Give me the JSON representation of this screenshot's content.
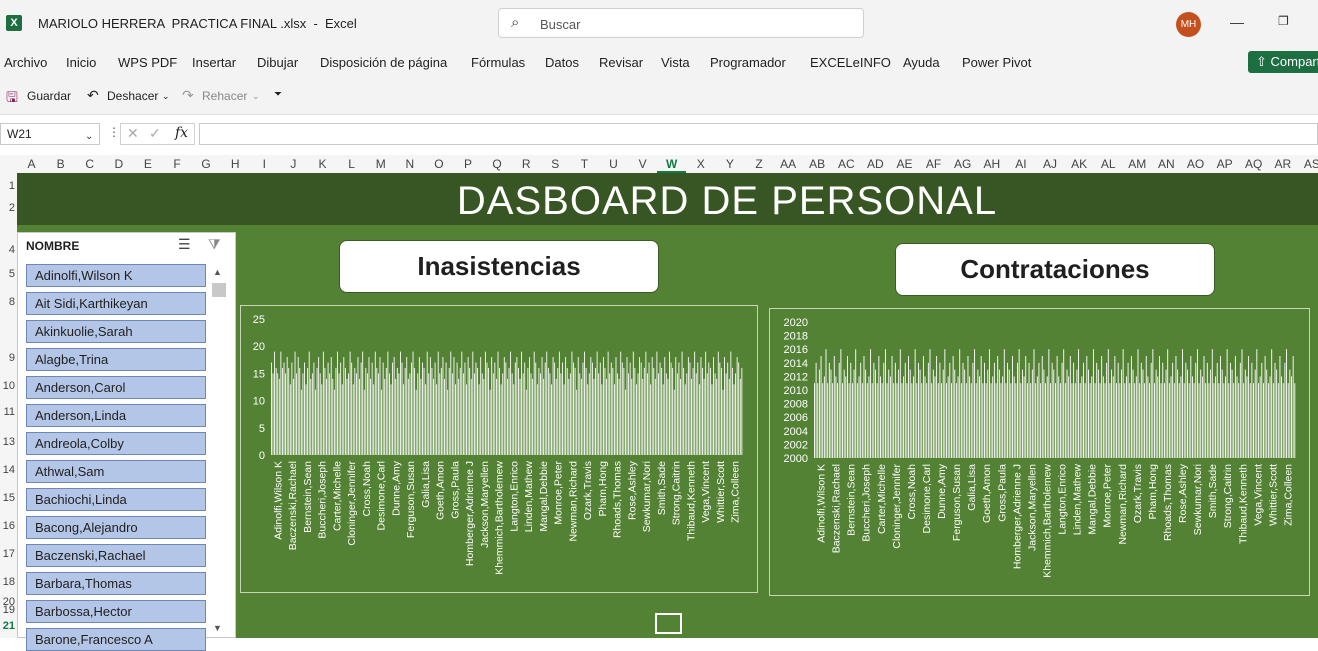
{
  "window": {
    "title": "MARIOLO HERRERA  PRACTICA FINAL .xlsx  -  Excel",
    "search_placeholder": "Buscar",
    "avatar_initials": "MH",
    "minimize_glyph": "—",
    "restore_glyph": "❐"
  },
  "menu": {
    "items": [
      "Archivo",
      "Inicio",
      "WPS PDF",
      "Insertar",
      "Dibujar",
      "Disposición de página",
      "Fórmulas",
      "Datos",
      "Revisar",
      "Vista",
      "Programador",
      "EXCELeINFO",
      "Ayuda",
      "Power Pivot"
    ],
    "share_label": "Compartir"
  },
  "toolbar": {
    "save_label": "Guardar",
    "undo_label": "Deshacer",
    "redo_label": "Rehacer"
  },
  "formula_bar": {
    "name_box": "W21",
    "fx_label": "fx",
    "formula": ""
  },
  "grid": {
    "columns": [
      "A",
      "B",
      "C",
      "D",
      "E",
      "F",
      "G",
      "H",
      "I",
      "J",
      "K",
      "L",
      "M",
      "N",
      "O",
      "P",
      "Q",
      "R",
      "S",
      "T",
      "U",
      "V",
      "W",
      "X",
      "Y",
      "Z",
      "AA",
      "AB",
      "AC",
      "AD",
      "AE",
      "AF",
      "AG",
      "AH",
      "AI",
      "AJ",
      "AK",
      "AL",
      "AM",
      "AN",
      "AO",
      "AP",
      "AQ",
      "AR",
      "AS"
    ],
    "rows": [
      "1",
      "2",
      "4",
      "5",
      "8",
      "9",
      "10",
      "11",
      "13",
      "14",
      "15",
      "16",
      "17",
      "18",
      "19",
      "20",
      "21"
    ],
    "selected_column": "W",
    "selected_row": "21"
  },
  "dashboard": {
    "title": "DASBOARD DE PERSONAL",
    "card1": "Inasistencias",
    "card2": "Contrataciones"
  },
  "slicer": {
    "header": "NOMBRE",
    "items": [
      "Adinolfi,Wilson K",
      "Ait Sidi,Karthikeyan",
      "Akinkuolie,Sarah",
      "Alagbe,Trina",
      "Anderson,Carol",
      "Anderson,Linda",
      "Andreola,Colby",
      "Athwal,Sam",
      "Bachiochi,Linda",
      "Bacong,Alejandro",
      "Baczenski,Rachael",
      "Barbara,Thomas",
      "Barbossa,Hector",
      "Barone,Francesco A"
    ]
  },
  "colors": {
    "banner": "#375623",
    "dashboard_bg": "#548235",
    "slicer_item": "#b4c6e7",
    "bar": "#ffffff",
    "excel_green": "#1d6f42"
  },
  "chart_data": [
    {
      "type": "bar",
      "title": "Inasistencias",
      "ylim": [
        0,
        25
      ],
      "yticks": [
        0,
        5,
        10,
        15,
        20,
        25
      ],
      "category_labels": [
        "Adinolfi,Wilson K",
        "Baczenski,Rachael",
        "Bernstein,Sean",
        "Buccheri,Joseph",
        "Carter,Michelle",
        "Cloninger,Jennifer",
        "Cross,Noah",
        "Desimone,Carl",
        "Dunne,Amy",
        "Ferguson,Susan",
        "Galia,Lisa",
        "Goeth,Amon",
        "Gross,Paula",
        "Homberger,Adrienne J",
        "Jackson,Maryellen",
        "Khemmich,Bartholemew",
        "Langton,Enrico",
        "Linden,Mathew",
        "Mangal,Debbie",
        "Monroe,Peter",
        "Newman,Richard",
        "Ozark,Travis",
        "Pham,Hong",
        "Rhoads,Thomas",
        "Rose,Ashley",
        "Sewkumar,Nori",
        "Smith,Sade",
        "Strong,Caitrin",
        "Thibaud,Kenneth",
        "Vega,Vincent",
        "Whittier,Scott",
        "Zima,Colleen"
      ],
      "values": [
        17,
        15,
        19,
        16,
        15,
        14,
        19,
        16,
        17,
        15,
        18,
        16,
        13,
        17,
        14,
        19,
        15,
        18,
        16,
        12,
        15,
        17,
        13,
        16,
        19,
        14,
        15,
        17,
        12,
        16,
        18,
        15,
        13,
        19,
        16,
        14,
        17,
        15,
        18,
        14,
        12,
        16,
        19,
        15,
        17,
        13,
        18,
        16,
        14,
        15,
        19,
        17,
        13,
        16,
        15,
        18,
        14,
        17,
        19,
        12,
        16,
        15,
        18,
        14,
        17,
        13,
        19,
        16,
        15,
        18,
        12,
        17,
        14,
        16,
        19,
        15,
        13,
        17,
        18,
        14,
        16,
        15,
        19,
        17,
        13,
        16,
        18,
        14,
        15,
        17,
        19,
        16,
        12,
        15,
        18,
        14,
        17,
        16,
        13,
        19,
        15,
        18,
        16,
        14,
        17,
        13,
        19,
        15,
        16,
        18,
        14,
        17,
        12,
        16,
        19,
        15,
        18,
        13,
        17,
        14,
        16,
        19,
        15,
        17,
        13,
        18,
        16,
        14,
        19,
        15,
        17,
        16,
        13,
        18,
        15,
        14,
        19,
        17,
        16,
        12,
        18,
        15,
        17,
        14,
        19,
        16,
        13,
        15,
        18,
        17,
        14,
        16,
        19,
        15,
        13,
        17,
        18,
        16,
        14,
        19,
        15,
        17,
        12,
        16,
        18,
        15,
        14,
        19,
        17,
        13,
        16,
        15,
        18,
        14,
        17,
        19,
        16,
        15,
        13,
        18,
        17,
        14,
        16,
        19,
        15,
        17,
        13,
        18,
        16,
        14,
        15,
        19,
        17,
        16,
        12,
        18,
        15,
        14,
        17,
        19,
        16,
        13,
        15,
        18,
        17,
        14,
        16,
        19,
        15,
        17,
        13,
        18,
        16,
        14,
        19,
        15,
        17,
        16,
        13,
        18,
        15,
        14,
        19,
        17,
        16,
        12,
        18,
        15,
        17,
        14,
        19,
        16,
        13,
        15,
        18,
        17,
        14,
        16,
        19,
        15,
        17,
        13,
        18,
        16,
        14,
        19,
        15,
        17,
        16,
        13,
        18,
        15,
        14,
        19,
        17,
        16,
        12,
        18,
        15,
        17,
        14,
        19,
        16,
        13,
        15,
        18,
        17,
        14,
        16,
        19,
        15,
        17,
        13,
        18,
        16,
        14,
        19,
        15,
        17,
        16,
        13,
        18,
        15,
        14,
        19,
        17,
        16,
        12,
        18,
        15,
        17,
        14,
        19,
        16,
        13,
        15,
        18,
        17,
        14,
        16
      ]
    },
    {
      "type": "bar",
      "title": "Contrataciones",
      "ylim": [
        2000,
        2020
      ],
      "yticks": [
        2000,
        2002,
        2004,
        2006,
        2008,
        2010,
        2012,
        2014,
        2016,
        2018,
        2020
      ],
      "category_labels": [
        "Adinolfi,Wilson K",
        "Baczenski,Rachael",
        "Bernstein,Sean",
        "Buccheri,Joseph",
        "Carter,Michelle",
        "Cloninger,Jennifer",
        "Cross,Noah",
        "Desimone,Carl",
        "Dunne,Amy",
        "Ferguson,Susan",
        "Galia,Lisa",
        "Goeth,Amon",
        "Gross,Paula",
        "Homberger,Adrienne J",
        "Jackson,Maryellen",
        "Khemmich,Bartholemew",
        "Langton,Enrico",
        "Linden,Mathew",
        "Mangal,Debbie",
        "Monroe,Peter",
        "Newman,Richard",
        "Ozark,Travis",
        "Pham,Hong",
        "Rhoads,Thomas",
        "Rose,Ashley",
        "Sewkumar,Nori",
        "Smith,Sade",
        "Strong,Caitrin",
        "Thibaud,Kenneth",
        "Vega,Vincent",
        "Whittier,Scott",
        "Zima,Colleen"
      ],
      "values": [
        2011,
        2014,
        2011,
        2013,
        2015,
        2011,
        2012,
        2016,
        2011,
        2014,
        2013,
        2011,
        2015,
        2012,
        2011,
        2014,
        2016,
        2011,
        2013,
        2012,
        2015,
        2011,
        2014,
        2011,
        2013,
        2016,
        2011,
        2012,
        2014,
        2011,
        2015,
        2013,
        2011,
        2012,
        2016,
        2011,
        2014,
        2013,
        2011,
        2015,
        2012,
        2011,
        2014,
        2016,
        2011,
        2013,
        2012,
        2015,
        2011,
        2014,
        2011,
        2013,
        2016,
        2011,
        2012,
        2014,
        2011,
        2015,
        2013,
        2011,
        2012,
        2016,
        2011,
        2014,
        2013,
        2011,
        2015,
        2012,
        2011,
        2014,
        2016,
        2011,
        2013,
        2012,
        2015,
        2011,
        2014,
        2011,
        2013,
        2016,
        2011,
        2012,
        2014,
        2011,
        2015,
        2013,
        2011,
        2012,
        2016,
        2011,
        2014,
        2013,
        2011,
        2015,
        2012,
        2011,
        2014,
        2016,
        2011,
        2013,
        2012,
        2015,
        2011,
        2014,
        2011,
        2013,
        2016,
        2011,
        2012,
        2014,
        2011,
        2015,
        2013,
        2011,
        2012,
        2016,
        2011,
        2014,
        2013,
        2011,
        2015,
        2012,
        2011,
        2014,
        2016,
        2011,
        2013,
        2012,
        2015,
        2011,
        2014,
        2011,
        2013,
        2016,
        2011,
        2012,
        2014,
        2011,
        2015,
        2013,
        2011,
        2012,
        2016,
        2011,
        2014,
        2013,
        2011,
        2015,
        2012,
        2011,
        2014,
        2016,
        2011,
        2013,
        2012,
        2015,
        2011,
        2014,
        2011,
        2013,
        2016,
        2011,
        2012,
        2014,
        2011,
        2015,
        2013,
        2011,
        2012,
        2016,
        2011,
        2014,
        2013,
        2011,
        2015,
        2012,
        2011,
        2014,
        2016,
        2011,
        2013,
        2012,
        2015,
        2011,
        2014,
        2011,
        2013,
        2016,
        2011,
        2012,
        2014,
        2011,
        2015,
        2013,
        2011,
        2012,
        2016,
        2011,
        2014,
        2013,
        2011,
        2015,
        2012,
        2011,
        2014,
        2016,
        2011,
        2013,
        2012,
        2015,
        2011,
        2014,
        2011,
        2013,
        2016,
        2011,
        2012,
        2014,
        2011,
        2015,
        2013,
        2011,
        2012,
        2016,
        2011,
        2014,
        2013,
        2011,
        2015,
        2012,
        2011,
        2014,
        2016,
        2011,
        2013,
        2012,
        2015,
        2011,
        2014,
        2011,
        2013,
        2016,
        2011,
        2012,
        2014,
        2011,
        2015,
        2013,
        2011,
        2012,
        2016,
        2011,
        2014,
        2013,
        2011,
        2015,
        2012,
        2011,
        2014,
        2016,
        2011,
        2013,
        2012,
        2015,
        2011,
        2014,
        2011,
        2013,
        2016,
        2011,
        2012,
        2014,
        2011,
        2015,
        2013,
        2011,
        2012,
        2016,
        2011,
        2014,
        2013,
        2011,
        2015,
        2012,
        2011,
        2014,
        2016,
        2011,
        2013,
        2012,
        2015,
        2011
      ]
    }
  ]
}
